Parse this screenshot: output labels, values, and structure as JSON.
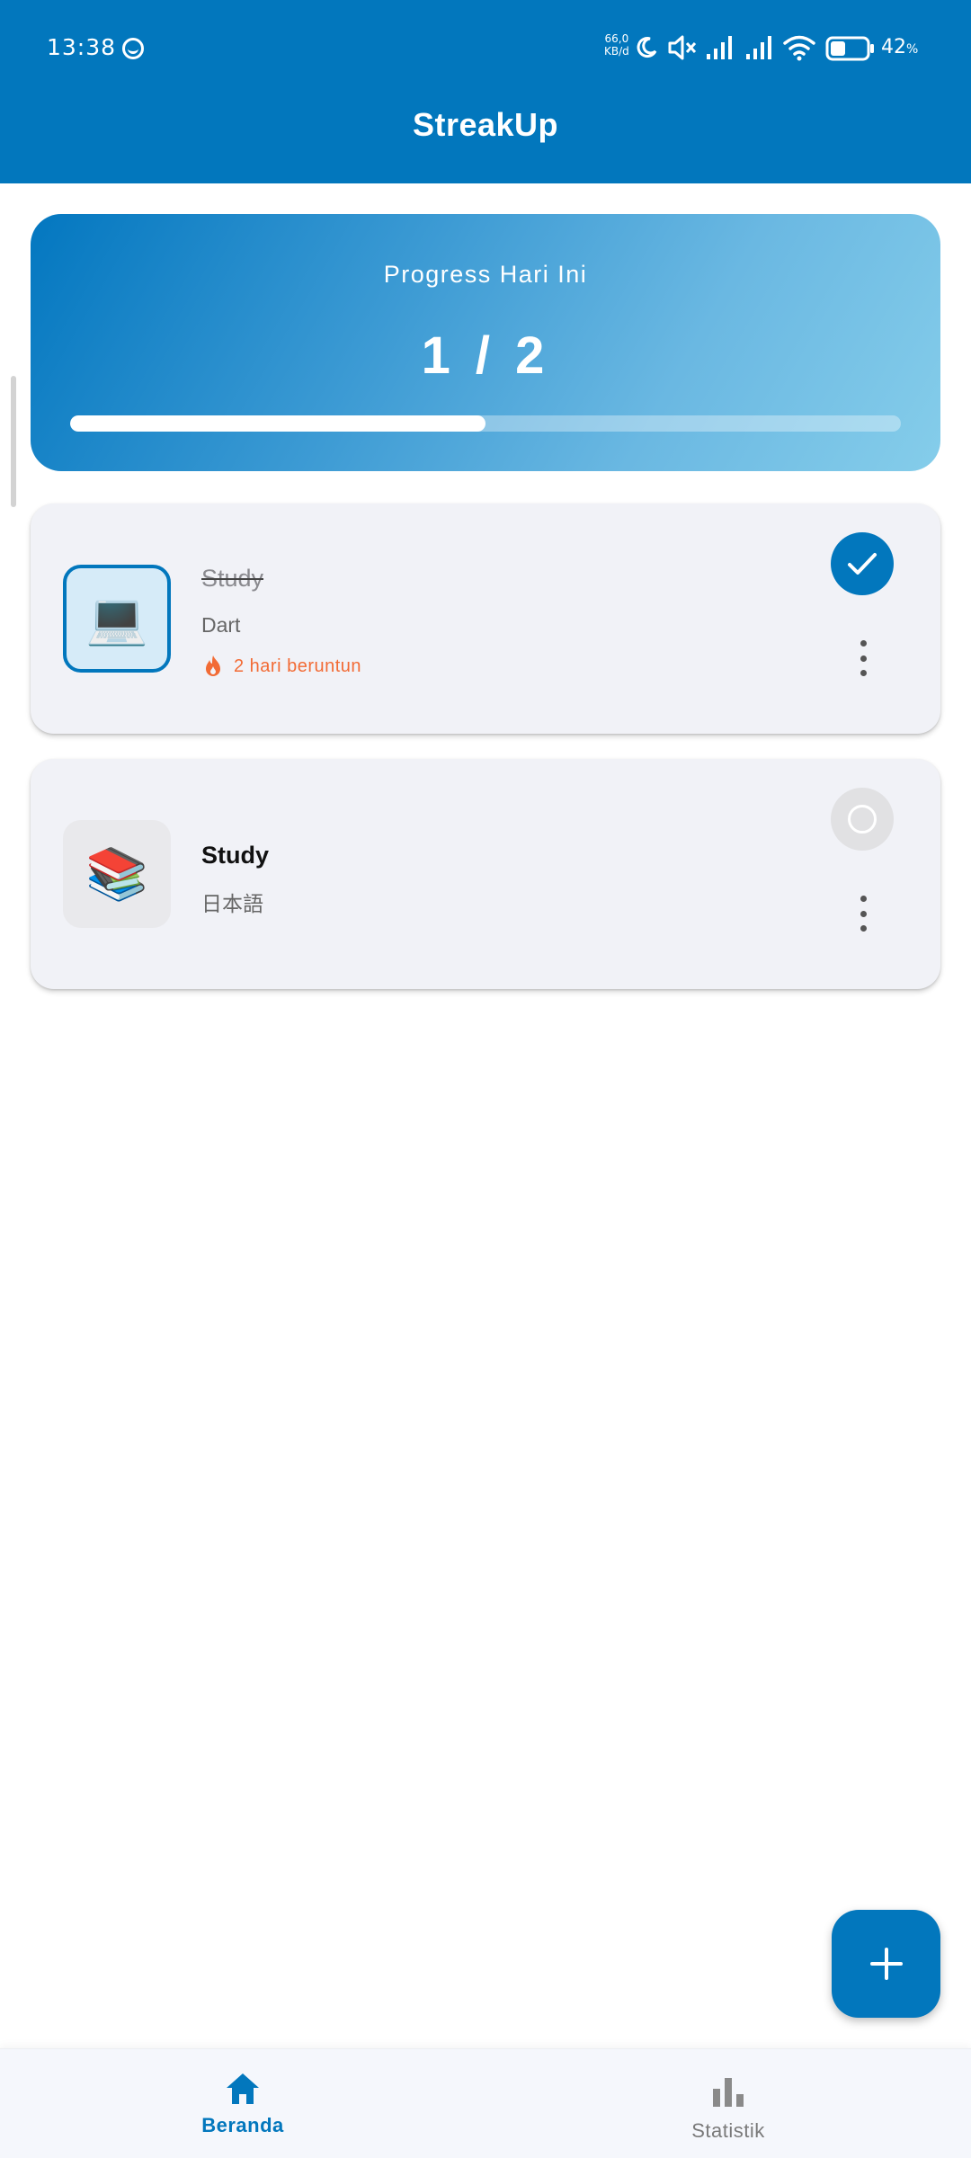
{
  "status_bar": {
    "time": "13:38",
    "net_speed_value": "66,0",
    "net_speed_unit": "KB/d",
    "battery_pct": "42",
    "battery_suffix": "%",
    "battery_level": 0.42
  },
  "app_bar": {
    "title": "StreakUp"
  },
  "progress_card": {
    "label": "Progress Hari Ini",
    "count": "1 / 2",
    "completed": 1,
    "total": 2
  },
  "habits": [
    {
      "emoji": "💻",
      "name": "Study",
      "description": "Dart",
      "done": true,
      "streak_text": "2 hari beruntun",
      "icon": "fire-icon"
    },
    {
      "emoji": "📚",
      "name": "Study",
      "description": "日本語",
      "done": false
    }
  ],
  "fab": {
    "icon": "plus-icon"
  },
  "bottom_nav": {
    "items": [
      {
        "label": "Beranda",
        "icon": "home-icon",
        "active": true
      },
      {
        "label": "Statistik",
        "icon": "bar-chart-icon",
        "active": false
      }
    ]
  },
  "colors": {
    "primary": "#0277bd",
    "streak": "#f26b35",
    "card_bg": "#f1f2f7"
  }
}
